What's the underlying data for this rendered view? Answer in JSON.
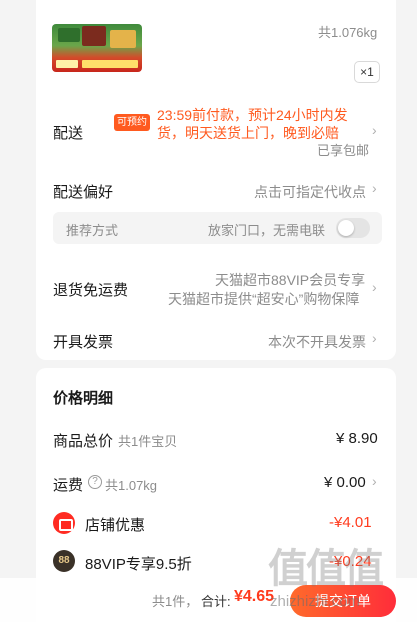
{
  "product": {
    "weight_total": "共1.076kg",
    "quantity": "×1"
  },
  "delivery": {
    "label": "配送",
    "badge": "可预约",
    "detail": "23:59前付款，预计24小时内发货，明天送货上门，晚到必赔",
    "free_shipping": "已享包邮"
  },
  "delivery_pref": {
    "label": "配送偏好",
    "value": "点击可指定代收点",
    "recommend_label": "推荐方式",
    "recommend_value": "放家门口，无需电联"
  },
  "return_shipping": {
    "label": "退货免运费",
    "line1": "天猫超市88VIP会员专享",
    "line2": "天猫超市提供“超安心”购物保障"
  },
  "invoice": {
    "label": "开具发票",
    "value": "本次不开具发票"
  },
  "price_detail": {
    "title": "价格明细",
    "goods_label": "商品总价",
    "goods_sub": "共1件宝贝",
    "goods_value": "¥ 8.90",
    "shipping_label": "运费",
    "shipping_sub": "共1.07kg",
    "shipping_value": "¥ 0.00",
    "store_discount_label": "店铺优惠",
    "store_discount_value": "-¥4.01",
    "vip_label": "88VIP专享9.5折",
    "vip_value": "-¥0.24"
  },
  "footer": {
    "count": "共1件，",
    "total_label": "合计:",
    "total_value": "¥4.65",
    "submit": "提交订单"
  },
  "watermark": {
    "site": "zhizhizhi.com",
    "glyphs": "值值值"
  },
  "colors": {
    "accent": "#ff3b1e",
    "badge": "#ff5a1f"
  }
}
